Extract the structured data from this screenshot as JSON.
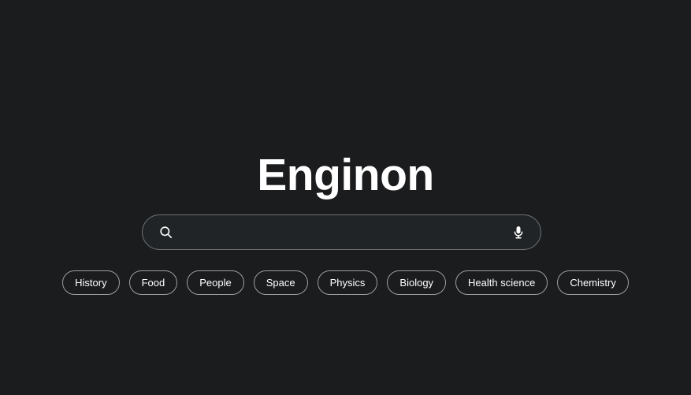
{
  "theme": {
    "background": "#1a1c1e",
    "search_field_background": "#212426",
    "search_field_border": "#6b7074",
    "chip_border": "#9aa0a4",
    "text_color": "#ffffff"
  },
  "brand": {
    "title": "Enginon"
  },
  "search": {
    "value": "",
    "placeholder": "",
    "search_icon": "search-icon",
    "mic_icon": "microphone-icon",
    "mic_label": "Search by voice"
  },
  "categories": {
    "chips": [
      {
        "label": "History"
      },
      {
        "label": "Food"
      },
      {
        "label": "People"
      },
      {
        "label": "Space"
      },
      {
        "label": "Physics"
      },
      {
        "label": "Biology"
      },
      {
        "label": "Health science"
      },
      {
        "label": "Chemistry"
      }
    ]
  }
}
